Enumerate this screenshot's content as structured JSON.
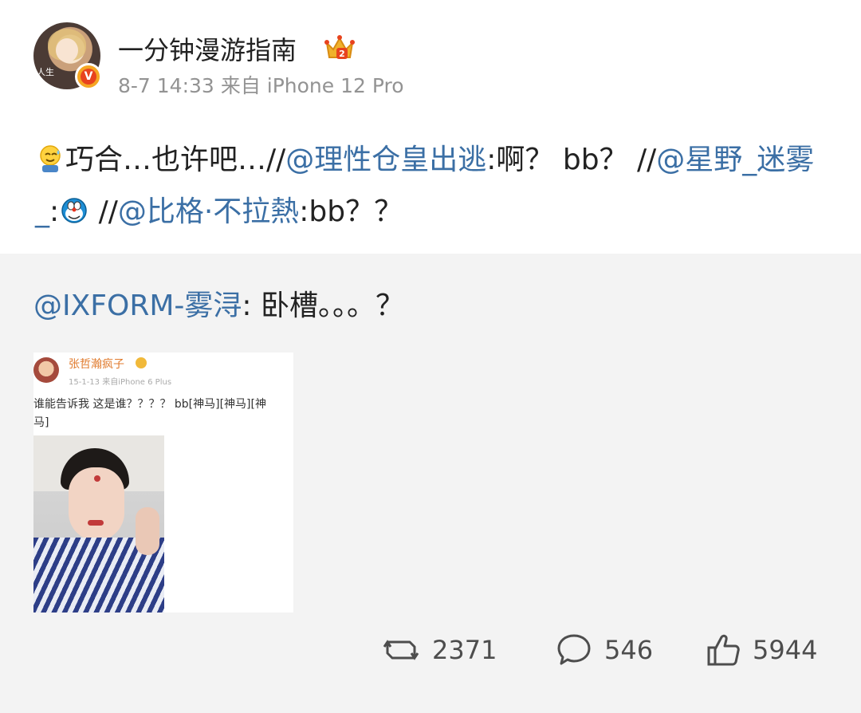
{
  "post": {
    "avatar_caption": "人生",
    "username": "一分钟漫游指南",
    "time": "8-7 14:33",
    "source": "来自 iPhone 12 Pro",
    "text": {
      "part1": "巧合…也许吧…//",
      "mention1": "@理性仓皇出逃",
      "part2": ":啊？ bb？ //",
      "mention2": "@星野_迷雾_",
      "part3": ":",
      "part4": " //",
      "mention3": "@比格·不拉熱",
      "part5": ":bb？？"
    }
  },
  "quote": {
    "mention": "@IXFORM-雾浔",
    "text": ": 卧槽。。。？",
    "image": {
      "name": "张哲瀚疯子",
      "meta": "15-1-13 来自iPhone 6 Plus",
      "line1": "谁能告诉我 这是谁？？？？ bb[神马][神马][神",
      "line2": "马]"
    }
  },
  "actions": {
    "repost_count": "2371",
    "comment_count": "546",
    "like_count": "5944"
  },
  "icons": {
    "verified": "verified-v-icon",
    "crown": "crown-level-icon",
    "emoji_1": "sweat-smile-emoji-icon",
    "emoji_2": "doraemon-emoji-icon",
    "repost": "repost-icon",
    "comment": "comment-icon",
    "like": "thumbs-up-icon"
  },
  "colors": {
    "mention": "#3b6fa5",
    "meta": "#939393",
    "quote_background": "#f3f3f3"
  }
}
